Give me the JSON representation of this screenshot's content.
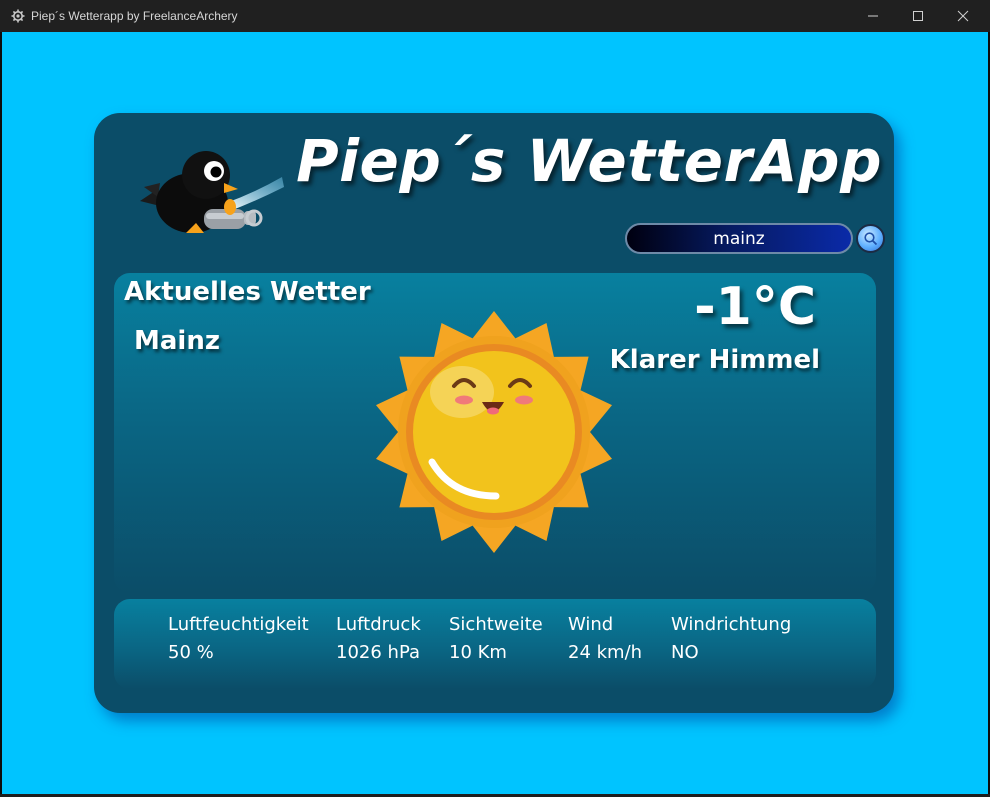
{
  "window": {
    "title": "Piep´s Wetterapp by FreelanceArchery"
  },
  "app": {
    "title": "Piep´s WetterApp"
  },
  "search": {
    "value": "mainz"
  },
  "current": {
    "heading": "Aktuelles Wetter",
    "city": "Mainz",
    "temperature": "-1°C",
    "condition": "Klarer Himmel",
    "icon": "sun-icon"
  },
  "details": [
    {
      "label": "Luftfeuchtigkeit",
      "value": "50 %"
    },
    {
      "label": "Luftdruck",
      "value": "1026 hPa"
    },
    {
      "label": "Sichtweite",
      "value": "10 Km"
    },
    {
      "label": "Wind",
      "value": "24 km/h"
    },
    {
      "label": "Windrichtung",
      "value": "NO"
    }
  ],
  "colors": {
    "background": "#00c4ff",
    "card": "#0b4d68",
    "panel": "#08809f",
    "titlebar": "#202020"
  }
}
